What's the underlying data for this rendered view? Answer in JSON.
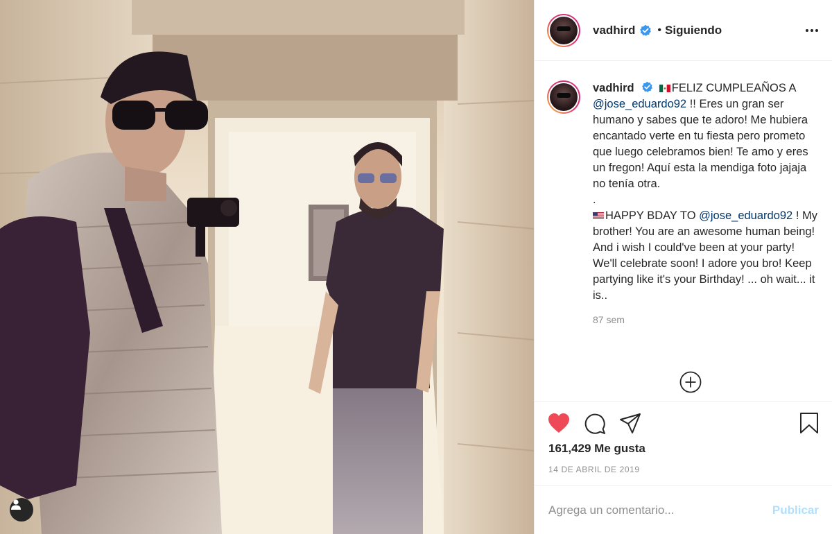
{
  "post": {
    "username": "vadhird",
    "verified": true,
    "follow_state": "Siguiendo",
    "dot": "•"
  },
  "caption": {
    "username": "vadhird",
    "line_es_prefix": "FELIZ CUMPLEAÑOS A",
    "mention": "@jose_eduardo92",
    "text_es": " !! Eres un gran ser humano y sabes que te adoro! Me hubiera encantado verte en tu fiesta pero prometo que luego celebramos bien! Te amo y eres un fregon! Aquí esta la mendiga foto jajaja no tenía otra.",
    "separator": ".",
    "line_en_prefix": "HAPPY BDAY TO ",
    "mention_en": "@jose_eduardo92",
    "text_en": " ! My brother! You are an awesome human being! And i wish I could've been at your party! We'll celebrate soon! I adore you bro! Keep partying like it's your Birthday! ... oh wait... it is..",
    "time_ago": "87 sem"
  },
  "stats": {
    "likes": "161,429 Me gusta",
    "date": "14 DE ABRIL DE 2019"
  },
  "comment": {
    "placeholder": "Agrega un comentario...",
    "publish_label": "Publicar"
  },
  "colors": {
    "heart": "#ed4956",
    "mention": "#00376b",
    "verified": "#3897f0",
    "publish_disabled": "#b2dffc"
  },
  "icons": {
    "like": "heart-icon",
    "comment": "comment-icon",
    "share": "paper-plane-icon",
    "save": "bookmark-icon",
    "more": "more-options-icon",
    "add": "plus-circle-icon",
    "tag": "user-tag-icon"
  }
}
